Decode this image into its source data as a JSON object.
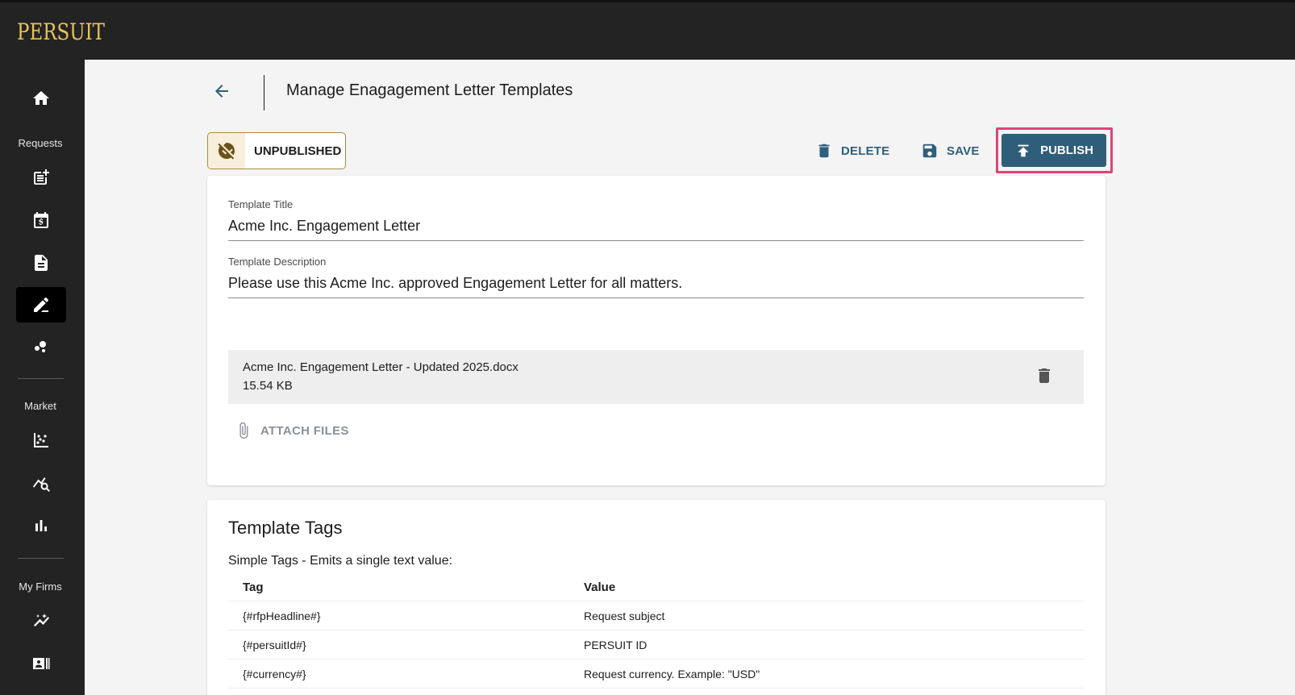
{
  "brand": {
    "logo_text": "PERSUIT",
    "logo_color": "#e7c45a"
  },
  "sidebar": {
    "sections": [
      {
        "label": "Requests"
      },
      {
        "label": "Market"
      },
      {
        "label": "My Firms"
      }
    ],
    "items": [
      {
        "icon": "home-icon"
      },
      {
        "icon": "post-add-icon"
      },
      {
        "icon": "calendar-dollar-icon"
      },
      {
        "icon": "document-icon"
      },
      {
        "icon": "edit-signature-icon",
        "active": true
      },
      {
        "icon": "bubbles-icon"
      },
      {
        "icon": "scatter-chart-icon"
      },
      {
        "icon": "query-stats-icon"
      },
      {
        "icon": "bar-chart-icon"
      },
      {
        "icon": "insights-icon"
      },
      {
        "icon": "contact-card-icon"
      }
    ]
  },
  "header": {
    "title": "Manage Enagagement Letter Templates"
  },
  "toolbar": {
    "status": "UNPUBLISHED",
    "delete_label": "DELETE",
    "save_label": "SAVE",
    "publish_label": "PUBLISH"
  },
  "form": {
    "title_label": "Template Title",
    "title_value": "Acme Inc. Engagement Letter",
    "description_label": "Template Description",
    "description_value": "Please use this Acme Inc. approved Engagement Letter for all matters."
  },
  "attachment": {
    "file_name": "Acme Inc. Engagement Letter - Updated 2025.docx",
    "file_size": "15.54 KB",
    "attach_label": "ATTACH FILES"
  },
  "tags": {
    "title": "Template Tags",
    "subtitle": "Simple Tags - Emits a single text value:",
    "columns": [
      "Tag",
      "Value"
    ],
    "rows": [
      {
        "tag": "{#rfpHeadline#}",
        "value": "Request subject"
      },
      {
        "tag": "{#persuitId#}",
        "value": "PERSUIT ID"
      },
      {
        "tag": "{#currency#}",
        "value": "Request currency. Example: \"USD\""
      }
    ]
  },
  "colors": {
    "accent": "#2f5e7a",
    "highlight": "#e2417a",
    "sidebar_bg": "#232323"
  }
}
